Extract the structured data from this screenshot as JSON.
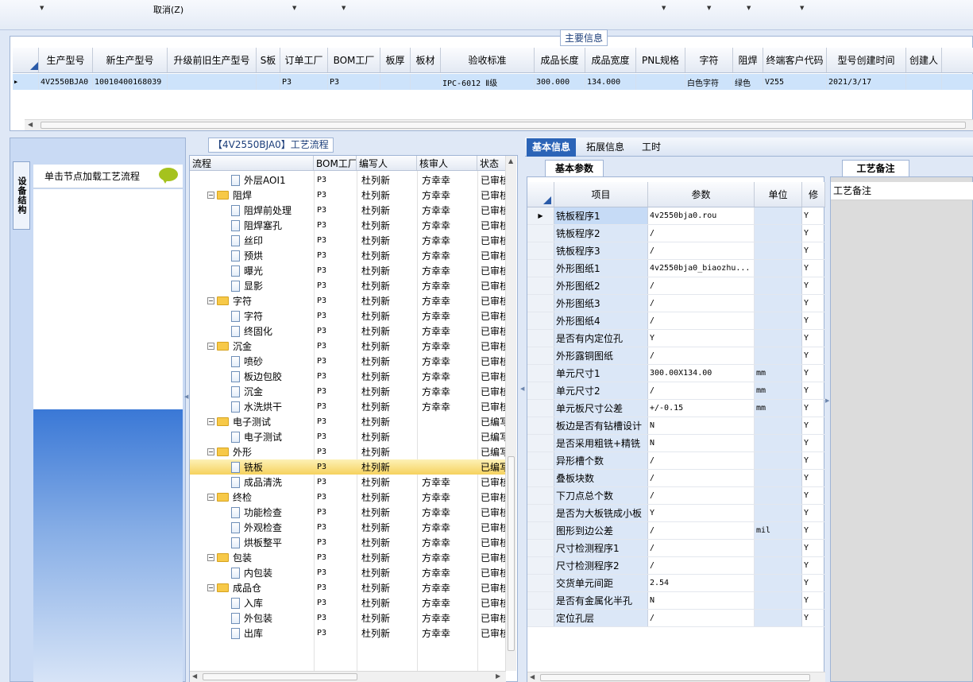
{
  "toolbar": {
    "cancel_label": "取消(Z)"
  },
  "main_info": {
    "title": "主要信息",
    "columns": [
      "生产型号",
      "新生产型号",
      "升级前旧生产型号",
      "S板",
      "订单工厂",
      "BOM工厂",
      "板厚",
      "板材",
      "验收标准",
      "成品长度",
      "成品宽度",
      "PNL规格",
      "字符",
      "阻焊",
      "终端客户代码",
      "型号创建时间",
      "创建人"
    ],
    "row": [
      "4V2550BJA0",
      "10010400168039",
      "",
      "",
      "P3",
      "P3",
      "",
      "",
      "IPC-6012 Ⅱ级",
      "300.000",
      "134.000",
      "",
      "白色字符",
      "绿色",
      "V255",
      "2021/3/17",
      ""
    ]
  },
  "left": {
    "vertical_tab": "设备结构",
    "hint": "单击节点加载工艺流程"
  },
  "process": {
    "title": "【4V2550BJA0】工艺流程",
    "columns": [
      "流程",
      "BOM工厂",
      "编写人",
      "核审人",
      "状态"
    ],
    "rows": [
      {
        "name": "外层AOI1",
        "type": "doc",
        "level": 2,
        "bom": "P3",
        "author": "杜列新",
        "reviewer": "方幸幸",
        "status": "已审核"
      },
      {
        "name": "阻焊",
        "type": "folder",
        "level": 1,
        "bom": "P3",
        "author": "杜列新",
        "reviewer": "方幸幸",
        "status": "已审核"
      },
      {
        "name": "阻焊前处理",
        "type": "doc",
        "level": 2,
        "bom": "P3",
        "author": "杜列新",
        "reviewer": "方幸幸",
        "status": "已审核"
      },
      {
        "name": "阻焊塞孔",
        "type": "doc",
        "level": 2,
        "bom": "P3",
        "author": "杜列新",
        "reviewer": "方幸幸",
        "status": "已审核"
      },
      {
        "name": "丝印",
        "type": "doc",
        "level": 2,
        "bom": "P3",
        "author": "杜列新",
        "reviewer": "方幸幸",
        "status": "已审核"
      },
      {
        "name": "预烘",
        "type": "doc",
        "level": 2,
        "bom": "P3",
        "author": "杜列新",
        "reviewer": "方幸幸",
        "status": "已审核"
      },
      {
        "name": "曝光",
        "type": "doc",
        "level": 2,
        "bom": "P3",
        "author": "杜列新",
        "reviewer": "方幸幸",
        "status": "已审核"
      },
      {
        "name": "显影",
        "type": "doc",
        "level": 2,
        "bom": "P3",
        "author": "杜列新",
        "reviewer": "方幸幸",
        "status": "已审核"
      },
      {
        "name": "字符",
        "type": "folder",
        "level": 1,
        "bom": "P3",
        "author": "杜列新",
        "reviewer": "方幸幸",
        "status": "已审核"
      },
      {
        "name": "字符",
        "type": "doc",
        "level": 2,
        "bom": "P3",
        "author": "杜列新",
        "reviewer": "方幸幸",
        "status": "已审核"
      },
      {
        "name": "终固化",
        "type": "doc",
        "level": 2,
        "bom": "P3",
        "author": "杜列新",
        "reviewer": "方幸幸",
        "status": "已审核"
      },
      {
        "name": "沉金",
        "type": "folder",
        "level": 1,
        "bom": "P3",
        "author": "杜列新",
        "reviewer": "方幸幸",
        "status": "已审核"
      },
      {
        "name": "喷砂",
        "type": "doc",
        "level": 2,
        "bom": "P3",
        "author": "杜列新",
        "reviewer": "方幸幸",
        "status": "已审核"
      },
      {
        "name": "板边包胶",
        "type": "doc",
        "level": 2,
        "bom": "P3",
        "author": "杜列新",
        "reviewer": "方幸幸",
        "status": "已审核"
      },
      {
        "name": "沉金",
        "type": "doc",
        "level": 2,
        "bom": "P3",
        "author": "杜列新",
        "reviewer": "方幸幸",
        "status": "已审核"
      },
      {
        "name": "水洗烘干",
        "type": "doc",
        "level": 2,
        "bom": "P3",
        "author": "杜列新",
        "reviewer": "方幸幸",
        "status": "已审核"
      },
      {
        "name": "电子测试",
        "type": "folder",
        "level": 1,
        "bom": "P3",
        "author": "杜列新",
        "reviewer": "",
        "status": "已编写"
      },
      {
        "name": "电子测试",
        "type": "doc",
        "level": 2,
        "bom": "P3",
        "author": "杜列新",
        "reviewer": "",
        "status": "已编写"
      },
      {
        "name": "外形",
        "type": "folder",
        "level": 1,
        "bom": "P3",
        "author": "杜列新",
        "reviewer": "",
        "status": "已编写"
      },
      {
        "name": "铣板",
        "type": "doc",
        "level": 2,
        "bom": "P3",
        "author": "杜列新",
        "reviewer": "",
        "status": "已编写",
        "selected": true
      },
      {
        "name": "成品清洗",
        "type": "doc",
        "level": 2,
        "bom": "P3",
        "author": "杜列新",
        "reviewer": "方幸幸",
        "status": "已审核"
      },
      {
        "name": "终检",
        "type": "folder",
        "level": 1,
        "bom": "P3",
        "author": "杜列新",
        "reviewer": "方幸幸",
        "status": "已审核"
      },
      {
        "name": "功能检查",
        "type": "doc",
        "level": 2,
        "bom": "P3",
        "author": "杜列新",
        "reviewer": "方幸幸",
        "status": "已审核"
      },
      {
        "name": "外观检查",
        "type": "doc",
        "level": 2,
        "bom": "P3",
        "author": "杜列新",
        "reviewer": "方幸幸",
        "status": "已审核"
      },
      {
        "name": "烘板整平",
        "type": "doc",
        "level": 2,
        "bom": "P3",
        "author": "杜列新",
        "reviewer": "方幸幸",
        "status": "已审核"
      },
      {
        "name": "包装",
        "type": "folder",
        "level": 1,
        "bom": "P3",
        "author": "杜列新",
        "reviewer": "方幸幸",
        "status": "已审核"
      },
      {
        "name": "内包装",
        "type": "doc",
        "level": 2,
        "bom": "P3",
        "author": "杜列新",
        "reviewer": "方幸幸",
        "status": "已审核"
      },
      {
        "name": "成品仓",
        "type": "folder",
        "level": 1,
        "bom": "P3",
        "author": "杜列新",
        "reviewer": "方幸幸",
        "status": "已审核"
      },
      {
        "name": "入库",
        "type": "doc",
        "level": 2,
        "bom": "P3",
        "author": "杜列新",
        "reviewer": "方幸幸",
        "status": "已审核"
      },
      {
        "name": "外包装",
        "type": "doc",
        "level": 2,
        "bom": "P3",
        "author": "杜列新",
        "reviewer": "方幸幸",
        "status": "已审核"
      },
      {
        "name": "出库",
        "type": "doc",
        "level": 2,
        "bom": "P3",
        "author": "杜列新",
        "reviewer": "方幸幸",
        "status": "已审核"
      }
    ]
  },
  "right": {
    "tabs": [
      "基本信息",
      "拓展信息",
      "工时"
    ],
    "subtab": "基本参数",
    "columns": [
      "项目",
      "参数",
      "单位",
      "修"
    ],
    "rows": [
      {
        "item": "铣板程序1",
        "value": "4v2550bja0.rou",
        "unit": "",
        "flag": "Y"
      },
      {
        "item": "铣板程序2",
        "value": "/",
        "unit": "",
        "flag": "Y"
      },
      {
        "item": "铣板程序3",
        "value": "/",
        "unit": "",
        "flag": "Y"
      },
      {
        "item": "外形图纸1",
        "value": "4v2550bja0_biaozhu...",
        "unit": "",
        "flag": "Y"
      },
      {
        "item": "外形图纸2",
        "value": "/",
        "unit": "",
        "flag": "Y"
      },
      {
        "item": "外形图纸3",
        "value": "/",
        "unit": "",
        "flag": "Y"
      },
      {
        "item": "外形图纸4",
        "value": "/",
        "unit": "",
        "flag": "Y"
      },
      {
        "item": "是否有内定位孔",
        "value": "Y",
        "unit": "",
        "flag": "Y"
      },
      {
        "item": "外形露铜图纸",
        "value": "/",
        "unit": "",
        "flag": "Y"
      },
      {
        "item": "单元尺寸1",
        "value": "300.00X134.00",
        "unit": "mm",
        "flag": "Y"
      },
      {
        "item": "单元尺寸2",
        "value": "/",
        "unit": "mm",
        "flag": "Y"
      },
      {
        "item": "单元板尺寸公差",
        "value": "+/-0.15",
        "unit": "mm",
        "flag": "Y"
      },
      {
        "item": "板边是否有钻槽设计",
        "value": "N",
        "unit": "",
        "flag": "Y"
      },
      {
        "item": "是否采用粗铣+精铣",
        "value": "N",
        "unit": "",
        "flag": "Y"
      },
      {
        "item": "异形槽个数",
        "value": "/",
        "unit": "",
        "flag": "Y"
      },
      {
        "item": "叠板块数",
        "value": "/",
        "unit": "",
        "flag": "Y"
      },
      {
        "item": "下刀点总个数",
        "value": "/",
        "unit": "",
        "flag": "Y"
      },
      {
        "item": "是否为大板铣成小板",
        "value": "Y",
        "unit": "",
        "flag": "Y"
      },
      {
        "item": "图形到边公差",
        "value": "/",
        "unit": "mil",
        "flag": "Y"
      },
      {
        "item": "尺寸检测程序1",
        "value": "/",
        "unit": "",
        "flag": "Y"
      },
      {
        "item": "尺寸检测程序2",
        "value": "/",
        "unit": "",
        "flag": "Y"
      },
      {
        "item": "交货单元间距",
        "value": "2.54",
        "unit": "",
        "flag": "Y"
      },
      {
        "item": "是否有金属化半孔",
        "value": "N",
        "unit": "",
        "flag": "Y"
      },
      {
        "item": "定位孔层",
        "value": "/",
        "unit": "",
        "flag": "Y"
      }
    ],
    "notes_tab": "工艺备注",
    "notes_header": "工艺备注"
  }
}
